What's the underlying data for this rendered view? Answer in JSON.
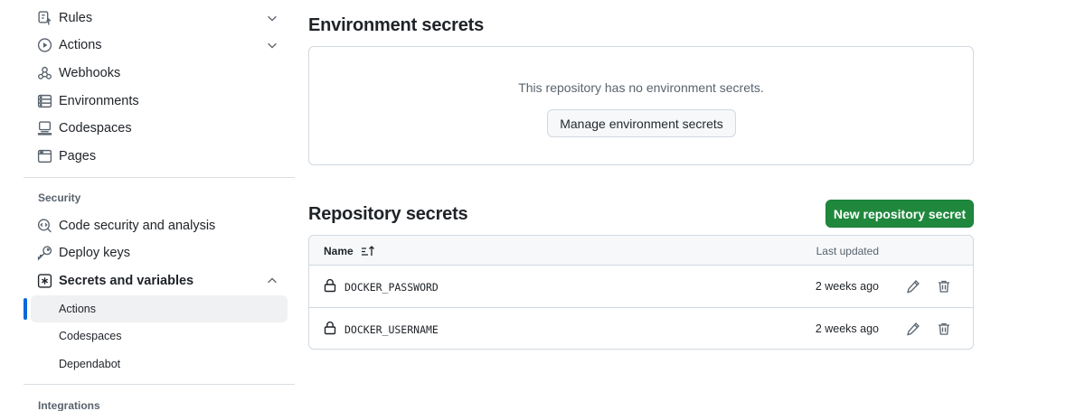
{
  "sidebar": {
    "items_top": [
      {
        "label": "Rules",
        "icon": "rules-icon",
        "expandable": true
      },
      {
        "label": "Actions",
        "icon": "play-icon",
        "expandable": true
      },
      {
        "label": "Webhooks",
        "icon": "webhook-icon"
      },
      {
        "label": "Environments",
        "icon": "server-icon"
      },
      {
        "label": "Codespaces",
        "icon": "codespaces-icon"
      },
      {
        "label": "Pages",
        "icon": "browser-icon"
      }
    ],
    "security_title": "Security",
    "security_items": [
      {
        "label": "Code security and analysis",
        "icon": "codescan-icon"
      },
      {
        "label": "Deploy keys",
        "icon": "key-icon"
      },
      {
        "label": "Secrets and variables",
        "icon": "asterisk-icon",
        "expanded": true
      }
    ],
    "secrets_subitems": [
      {
        "label": "Actions",
        "active": true
      },
      {
        "label": "Codespaces"
      },
      {
        "label": "Dependabot"
      }
    ],
    "integrations_title": "Integrations"
  },
  "env_secrets": {
    "title": "Environment secrets",
    "empty_message": "This repository has no environment secrets.",
    "manage_button": "Manage environment secrets"
  },
  "repo_secrets": {
    "title": "Repository secrets",
    "new_button": "New repository secret",
    "col_name": "Name",
    "col_updated": "Last updated",
    "rows": [
      {
        "name": "DOCKER_PASSWORD",
        "updated": "2 weeks ago"
      },
      {
        "name": "DOCKER_USERNAME",
        "updated": "2 weeks ago"
      }
    ]
  },
  "colors": {
    "accent": "#0969da",
    "primary_button": "#1f883d",
    "border": "#d1d9e0",
    "muted_text": "#59636e"
  }
}
